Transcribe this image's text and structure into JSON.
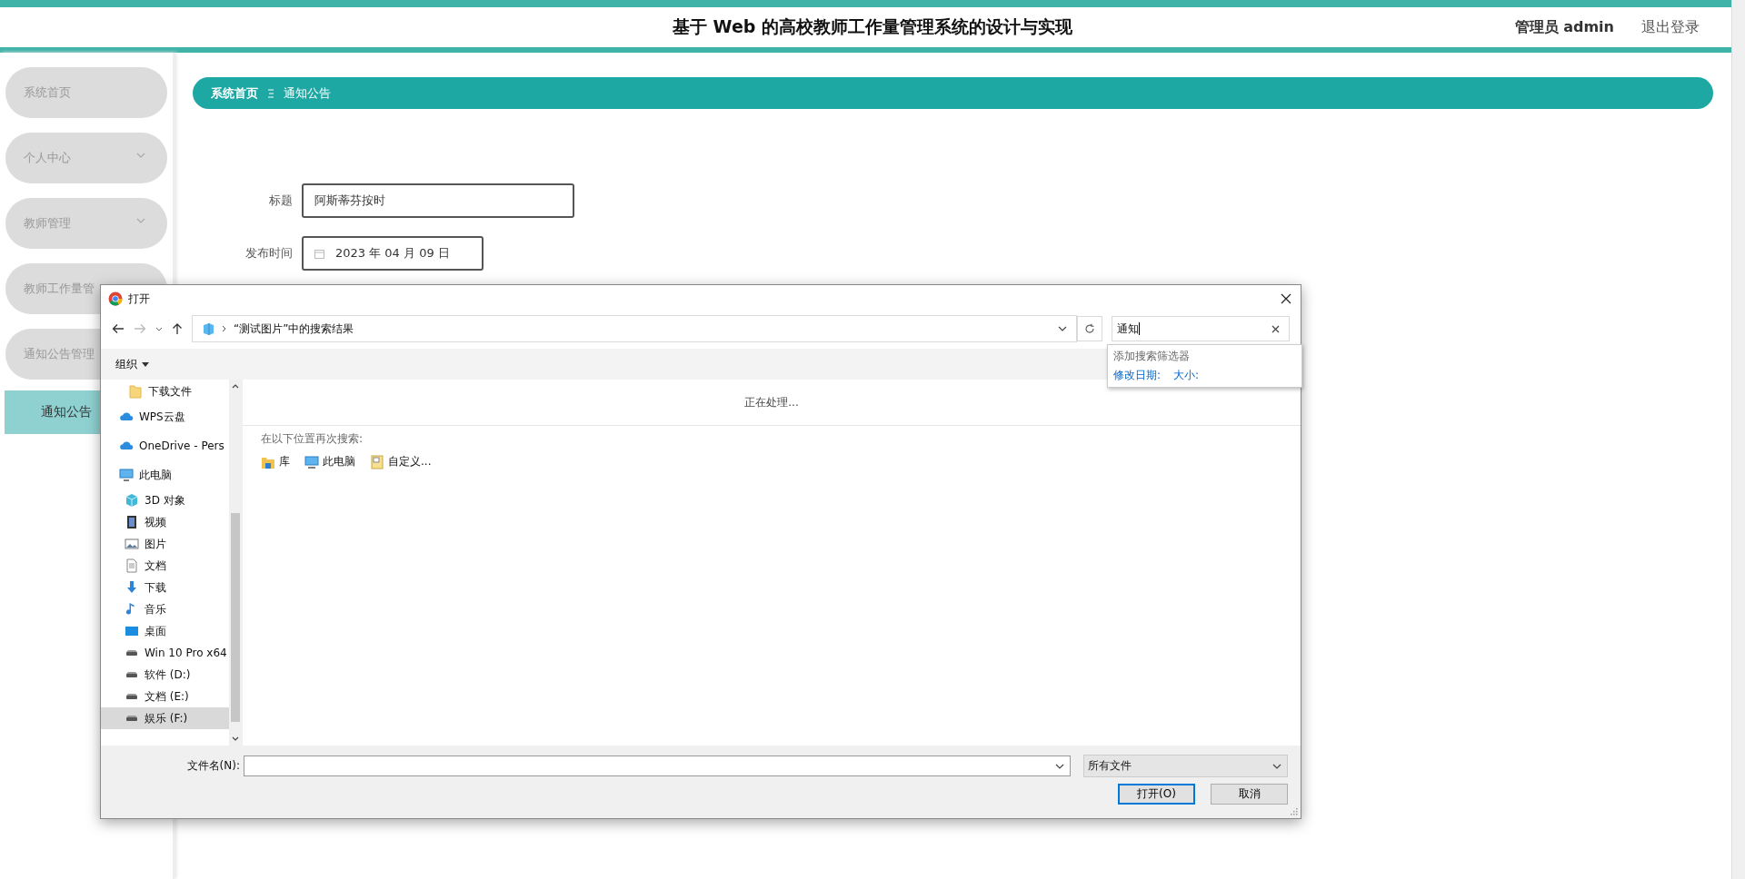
{
  "header": {
    "title": "基于 Web 的高校教师工作量管理系统的设计与实现",
    "user": "管理员 admin",
    "logout": "退出登录"
  },
  "sidebar": {
    "items": [
      {
        "label": "系统首页",
        "kind": "link",
        "selected": false
      },
      {
        "label": "个人中心",
        "kind": "group",
        "selected": false
      },
      {
        "label": "教师管理",
        "kind": "group",
        "selected": false
      },
      {
        "label": "教师工作量管",
        "kind": "group",
        "selected": false
      },
      {
        "label": "通知公告管理",
        "kind": "group",
        "selected": false
      },
      {
        "label": "通知公告",
        "kind": "sub",
        "selected": true
      }
    ]
  },
  "breadcrumb": [
    "系统首页",
    "通知公告"
  ],
  "form": {
    "fields": [
      {
        "label": "标题",
        "value": "阿斯蒂芬按时",
        "kind": "text"
      },
      {
        "label": "发布时间",
        "value": "2023 年 04 月 09 日",
        "kind": "date"
      }
    ]
  },
  "dialog": {
    "title": "打开",
    "address": "“测试图片”中的搜索结果",
    "search": "通知",
    "search_menu": {
      "heading": "添加搜索筛选器",
      "filters": [
        "修改日期:",
        "大小:"
      ]
    },
    "organize": "组织",
    "nav_items": [
      {
        "label": "下载文件",
        "kind": "folder",
        "selected": false
      },
      {
        "label": "WPS云盘",
        "kind": "cloud",
        "selected": false
      },
      {
        "label": "OneDrive - Pers",
        "kind": "cloud",
        "selected": false
      },
      {
        "label": "此电脑",
        "kind": "computer",
        "selected": false,
        "children": [
          {
            "label": "3D 对象",
            "kind": "cube",
            "selected": false
          },
          {
            "label": "视频",
            "kind": "video",
            "selected": false
          },
          {
            "label": "图片",
            "kind": "pictures",
            "selected": false
          },
          {
            "label": "文档",
            "kind": "document",
            "selected": false
          },
          {
            "label": "下载",
            "kind": "download",
            "selected": false
          },
          {
            "label": "音乐",
            "kind": "music",
            "selected": false
          },
          {
            "label": "桌面",
            "kind": "desktop",
            "selected": false
          },
          {
            "label": "Win 10 Pro x64",
            "kind": "drive",
            "selected": false
          },
          {
            "label": "软件 (D:)",
            "kind": "drive",
            "selected": false
          },
          {
            "label": "文档 (E:)",
            "kind": "drive",
            "selected": false
          },
          {
            "label": "娱乐 (F:)",
            "kind": "drive",
            "selected": true
          }
        ]
      }
    ],
    "status": "正在处理...",
    "search_again": "在以下位置再次搜索:",
    "locations": [
      {
        "label": "库",
        "kind": "library"
      },
      {
        "label": "此电脑",
        "kind": "computer"
      },
      {
        "label": "自定义...",
        "kind": "custom"
      }
    ],
    "filename_label": "文件名(N):",
    "filetype": "所有文件",
    "buttons": [
      {
        "label": "打开(O)",
        "kind": "primary"
      },
      {
        "label": "取消",
        "kind": "normal"
      }
    ]
  }
}
